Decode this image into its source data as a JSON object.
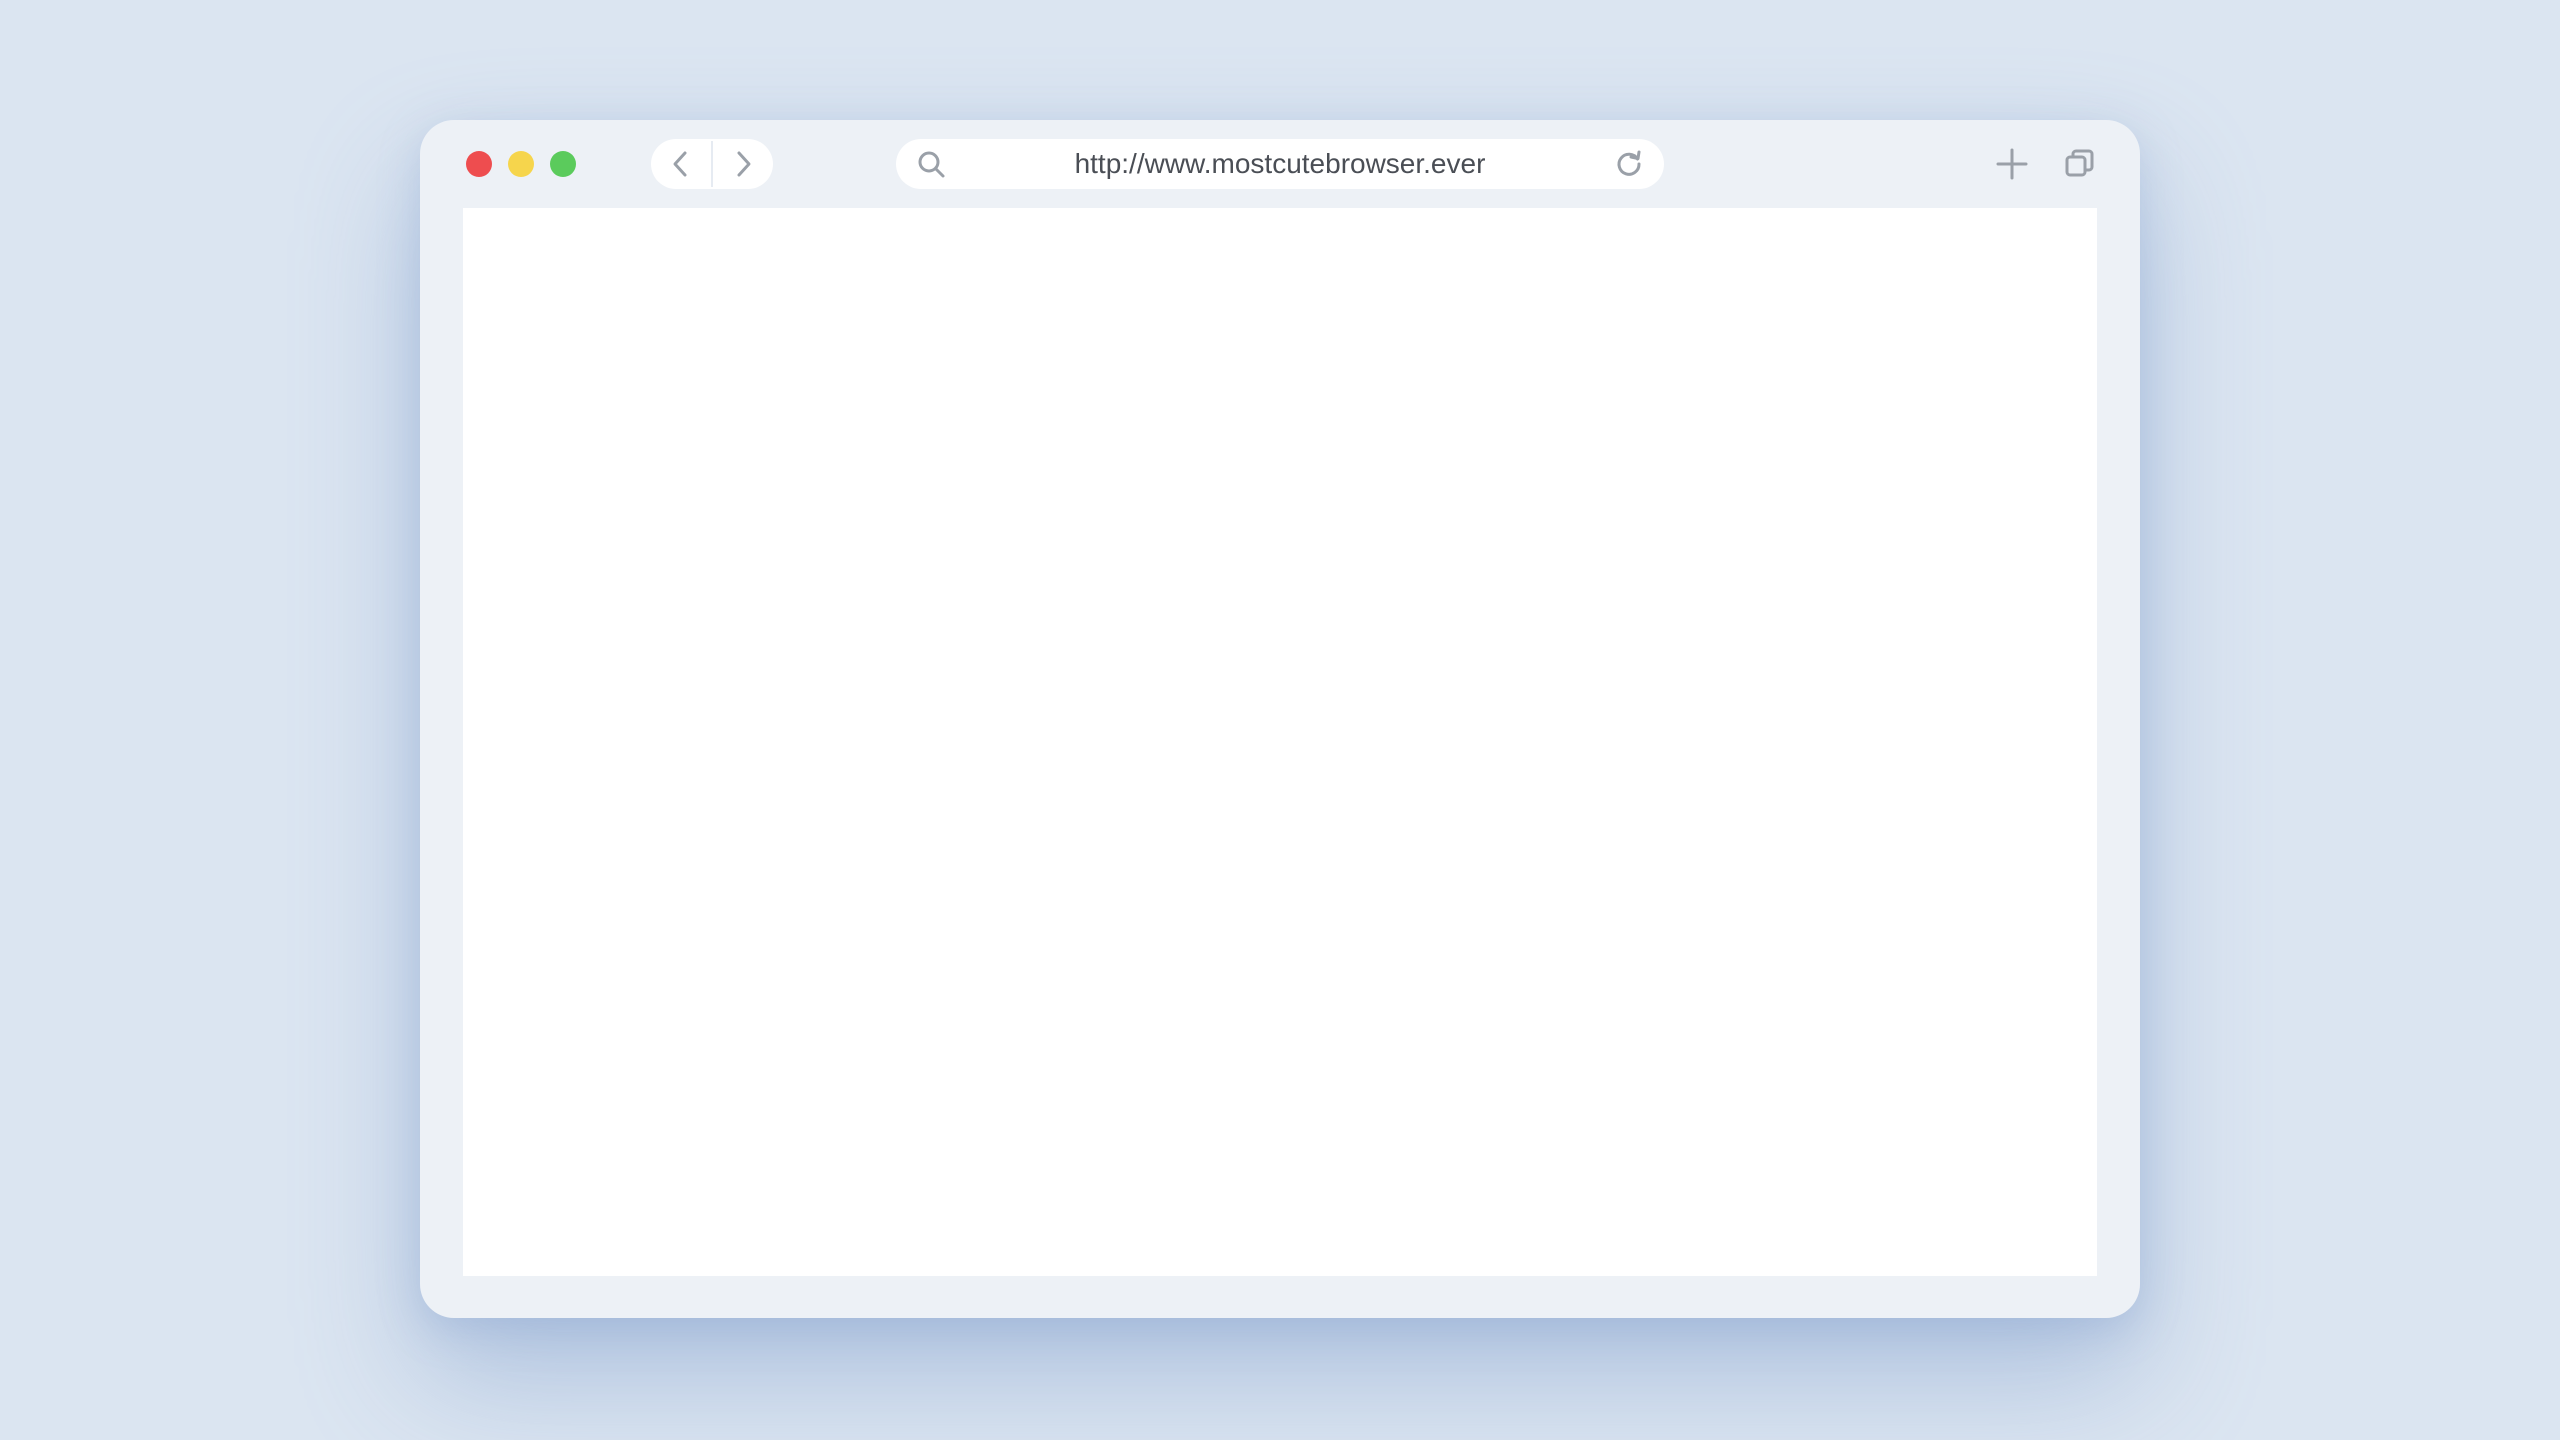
{
  "colors": {
    "background": "#dbe5f1",
    "window": "#edf1f6",
    "close": "#ee4d4f",
    "minimize": "#f6d54c",
    "maximize": "#5bcb5c",
    "icon": "#9aa0a8"
  },
  "navigation": {
    "back_icon": "chevron-left-icon",
    "forward_icon": "chevron-right-icon"
  },
  "address_bar": {
    "url": "http://www.mostcutebrowser.ever",
    "search_icon": "search-icon",
    "reload_icon": "reload-icon"
  },
  "toolbar": {
    "new_tab_icon": "plus-icon",
    "tabs_icon": "tabs-icon"
  }
}
